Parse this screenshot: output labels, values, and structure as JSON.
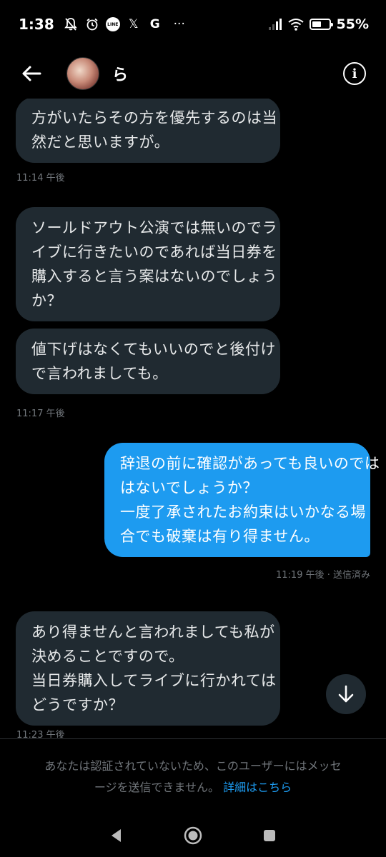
{
  "status_bar": {
    "time": "1:38",
    "line_label": "LINE",
    "x_label": "𝕏",
    "g_label": "G",
    "more": "···",
    "battery_percent": "55%",
    "battery_level": 0.55
  },
  "header": {
    "username": "ら",
    "info_glyph": "i"
  },
  "messages": [
    {
      "direction": "incoming",
      "lines": [
        "方がいたらその方を優先するのは当",
        "然だと思いますが。"
      ]
    },
    {
      "direction": "incoming",
      "lines": [
        "ソールドアウト公演では無いのでラ",
        "イブに行きたいのであれば当日券を",
        "購入すると言う案はないのでしょう",
        "か？"
      ]
    },
    {
      "direction": "incoming",
      "lines": [
        "値下げはなくてもいいのでと後付け",
        "で言われましても。"
      ]
    },
    {
      "direction": "outgoing",
      "lines": [
        "辞退の前に確認があっても良いのでは",
        "はないでしょうか？",
        "一度了承されたお約束はいかなる場",
        "合でも破棄は有り得ません。"
      ]
    },
    {
      "direction": "incoming",
      "lines": [
        "あり得ませんと言われましても私が",
        "決めることですので。",
        "当日券購入してライブに行かれては",
        "どうですか？"
      ]
    }
  ],
  "timestamps": [
    "11:14 午後",
    "11:17 午後",
    "11:19 午後 · 送信済み",
    "11:23 午後"
  ],
  "notice": {
    "line1": "あなたは認証されていないため、このユーザーにはメッセ",
    "line2": "ージを送信できません。",
    "link": "詳細はこちら"
  },
  "colors": {
    "background": "#000000",
    "incoming_bubble": "#202a31",
    "outgoing_bubble": "#1d9bf0",
    "link": "#1d9bf0",
    "muted_text": "#71767b"
  }
}
